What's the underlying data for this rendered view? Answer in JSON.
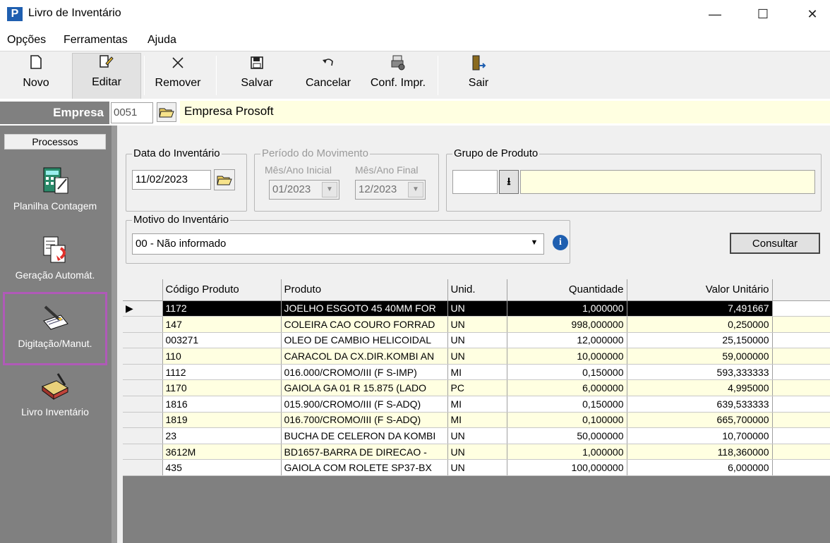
{
  "window": {
    "title": "Livro de Inventário",
    "app_icon": "P",
    "minimize_glyph": "—",
    "maximize_glyph": "☐",
    "close_glyph": "✕"
  },
  "menu": [
    "Opções",
    "Ferramentas",
    "Ajuda"
  ],
  "toolbar": {
    "novo": "Novo",
    "editar": "Editar",
    "remover": "Remover",
    "salvar": "Salvar",
    "cancelar": "Cancelar",
    "conf_impr": "Conf. Impr.",
    "sair": "Sair"
  },
  "empresa": {
    "label": "Empresa",
    "code": "0051",
    "name": "Empresa Prosoft"
  },
  "sidebar": {
    "header": "Processos",
    "items": [
      {
        "label": "Planilha Contagem",
        "icon": "spreadsheet-icon"
      },
      {
        "label": "Geração Automát.",
        "icon": "auto-generate-icon"
      },
      {
        "label": "Digitação/Manut.",
        "icon": "data-entry-icon"
      },
      {
        "label": "Livro Inventário",
        "icon": "book-icon"
      }
    ],
    "selected_index": 2,
    "highlight_color": "#b05ab8"
  },
  "filters": {
    "data_inventario": {
      "label": "Data do Inventário",
      "value": "11/02/2023"
    },
    "periodo": {
      "label": "Período do Movimento",
      "inicial_label": "Mês/Ano Inicial",
      "inicial_value": "01/2023",
      "final_label": "Mês/Ano Final",
      "final_value": "12/2023"
    },
    "grupo": {
      "label": "Grupo de Produto",
      "code": "",
      "name": ""
    },
    "motivo": {
      "label": "Motivo do Inventário",
      "value": "00 - Não informado"
    },
    "consultar": "Consultar"
  },
  "grid": {
    "columns": [
      "Código Produto",
      "Produto",
      "Unid.",
      "Quantidade",
      "Valor Unitário"
    ],
    "rows": [
      {
        "codigo": "1172",
        "produto": "JOELHO ESGOTO 45 40MM FOR",
        "unid": "UN",
        "qtd": "1,000000",
        "valor": "7,491667"
      },
      {
        "codigo": "147",
        "produto": "COLEIRA CAO COURO FORRAD",
        "unid": "UN",
        "qtd": "998,000000",
        "valor": "0,250000"
      },
      {
        "codigo": "003271",
        "produto": "OLEO DE CAMBIO HELICOIDAL",
        "unid": "UN",
        "qtd": "12,000000",
        "valor": "25,150000"
      },
      {
        "codigo": "110",
        "produto": "CARACOL DA CX.DIR.KOMBI AN",
        "unid": "UN",
        "qtd": "10,000000",
        "valor": "59,000000"
      },
      {
        "codigo": "1112",
        "produto": "016.000/CROMO/III (F S-IMP)",
        "unid": "MI",
        "qtd": "0,150000",
        "valor": "593,333333"
      },
      {
        "codigo": "1170",
        "produto": "GAIOLA GA 01 R 15.875 (LADO",
        "unid": "PC",
        "qtd": "6,000000",
        "valor": "4,995000"
      },
      {
        "codigo": "1816",
        "produto": "015.900/CROMO/III (F S-ADQ)",
        "unid": "MI",
        "qtd": "0,150000",
        "valor": "639,533333"
      },
      {
        "codigo": "1819",
        "produto": "016.700/CROMO/III (F S-ADQ)",
        "unid": "MI",
        "qtd": "0,100000",
        "valor": "665,700000"
      },
      {
        "codigo": "23",
        "produto": "BUCHA DE CELERON DA KOMBI",
        "unid": "UN",
        "qtd": "50,000000",
        "valor": "10,700000"
      },
      {
        "codigo": "3612M",
        "produto": "BD1657-BARRA DE DIRECAO -",
        "unid": "UN",
        "qtd": "1,000000",
        "valor": "118,360000"
      },
      {
        "codigo": "435",
        "produto": "GAIOLA COM ROLETE SP37-BX",
        "unid": "UN",
        "qtd": "100,000000",
        "valor": "6,000000"
      }
    ],
    "selected_row": 0,
    "row_indicator": "▶"
  }
}
